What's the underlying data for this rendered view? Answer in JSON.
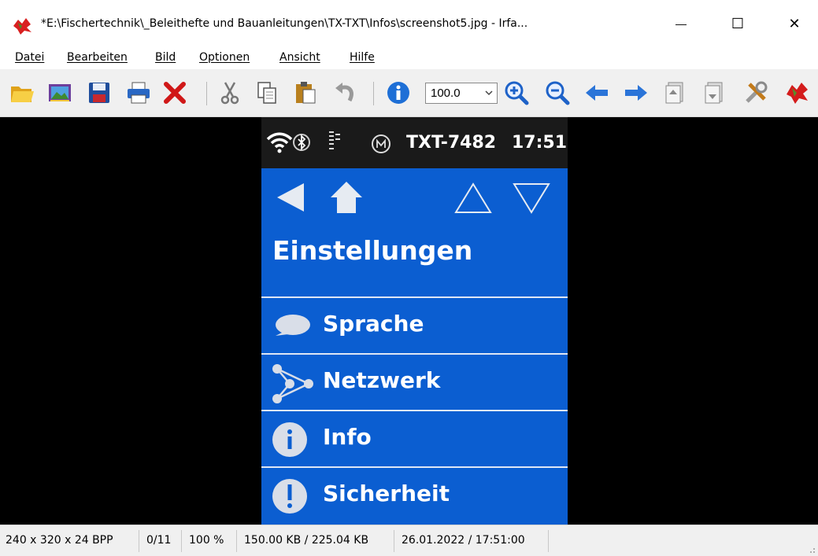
{
  "window": {
    "title": "*E:\\Fischertechnik\\_Beleithefte und Bauanleitungen\\TX-TXT\\Infos\\screenshot5.jpg - Irfa...",
    "minimize_glyph": "—",
    "maximize_glyph": "☐",
    "close_glyph": "✕"
  },
  "menu": [
    "Datei",
    "Bearbeiten",
    "Bild",
    "Optionen",
    "Ansicht",
    "Hilfe"
  ],
  "toolbar": {
    "icons": [
      "open-folder-icon",
      "thumbnails-icon",
      "save-icon",
      "print-icon",
      "delete-icon",
      "cut-icon",
      "copy-icon",
      "paste-icon",
      "undo-icon",
      "info-icon",
      "zoom-in-icon",
      "zoom-out-icon",
      "previous-icon",
      "next-icon",
      "first-page-icon",
      "last-page-icon",
      "settings-icon",
      "irfanview-icon"
    ],
    "zoom_value": "100.0"
  },
  "device": {
    "status_title": "TXT-7482",
    "status_time": "17:51",
    "heading": "Einstellungen",
    "menu_items": [
      {
        "label": "Sprache",
        "icon": "speech-bubble-icon"
      },
      {
        "label": "Netzwerk",
        "icon": "network-icon"
      },
      {
        "label": "Info",
        "icon": "info-circle-icon"
      },
      {
        "label": "Sicherheit",
        "icon": "exclamation-icon"
      }
    ]
  },
  "statusbar": {
    "dimensions": "240 x 320 x 24 BPP",
    "index": "0/11",
    "zoom": "100 %",
    "size": "150.00 KB / 225.04 KB",
    "datetime": "26.01.2022 / 17:51:00"
  },
  "colors": {
    "device_blue": "#0b5ed1",
    "device_status": "#1a1a1a",
    "viewer_bg": "#000000"
  }
}
